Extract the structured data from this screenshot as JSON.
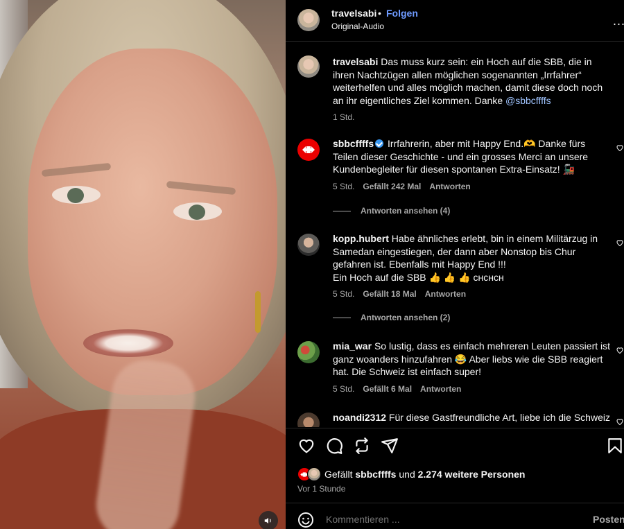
{
  "post": {
    "username": "travelsabi",
    "dot": "•",
    "follow_label": "Folgen",
    "audio_label": "Original-Audio",
    "more_label": "..."
  },
  "caption": {
    "username": "travelsabi",
    "text": "Das muss kurz sein: ein Hoch auf die SBB, die in ihren Nachtzügen allen möglichen sogenannten „Irrfahrer“ weiterhelfen und alles möglich machen, damit diese doch noch an ihr eigentliches Ziel kommen. Danke ",
    "mention": "@sbbcffffs",
    "time": "1 Std."
  },
  "comments": [
    {
      "username": "sbbcffffs",
      "text": "Irrfahrerin, aber mit Happy End.🫶 Danke fürs Teilen dieser Geschichte - und ein grosses Merci an unsere Kundenbegleiter für diesen spontanen Extra-Einsatz! 🚂",
      "time": "5 Std.",
      "likes": "Gefällt 242 Mal",
      "reply": "Antworten",
      "view_replies": "Antworten ansehen (4)"
    },
    {
      "username": "kopp.hubert",
      "text": "Habe ähnliches erlebt, bin in einem Militärzug in Samedan eingestiegen, der dann aber Nonstop bis Chur gefahren ist. Ebenfalls mit Happy End !!!",
      "text2": "Ein Hoch auf die SBB 👍 👍 👍 ᴄʜᴄʜᴄʜ",
      "time": "5 Std.",
      "likes": "Gefällt 18 Mal",
      "reply": "Antworten",
      "view_replies": "Antworten ansehen (2)"
    },
    {
      "username": "mia_war",
      "text": "So lustig, dass es einfach mehreren Leuten passiert ist ganz woanders hinzufahren 😂 Aber liebs wie die SBB reagiert hat. Die Schweiz ist einfach super!",
      "time": "5 Std.",
      "likes": "Gefällt 6 Mal",
      "reply": "Antworten"
    },
    {
      "username": "noandi2312",
      "text": "Für diese Gastfreundliche Art, liebe ich die Schweiz"
    }
  ],
  "likes_line": {
    "prefix": "Gefällt",
    "user": "sbbcffffs",
    "middle": "und",
    "others": "2.274 weitere Personen"
  },
  "posted_time": "Vor 1 Stunde",
  "comment_box": {
    "placeholder": "Kommentieren ...",
    "post_label": "Posten"
  },
  "icons": {
    "like": "heart-icon",
    "comment": "comment-icon",
    "share": "repost-icon",
    "send": "send-icon",
    "save": "bookmark-icon",
    "emoji": "emoji-icon",
    "sound": "speaker-icon"
  },
  "colors": {
    "background": "#000000",
    "follow_blue": "#6f9bff",
    "sbb_red": "#eb0000",
    "muted": "#a8a8a8",
    "verified": "#3897f0"
  }
}
